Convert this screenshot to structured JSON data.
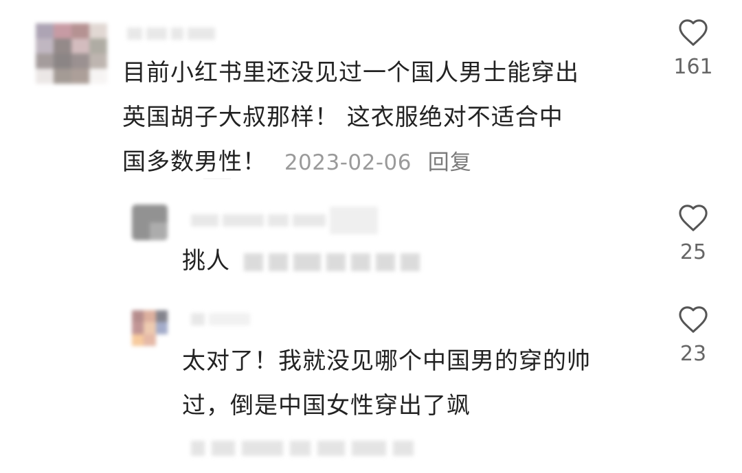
{
  "comments": [
    {
      "text_lines": [
        "目前小红书里还没见过一个国人男士能穿出",
        "英国胡子大叔那样！ 这衣服绝对不适合中",
        "国多数男性！"
      ],
      "date": "2023-02-06",
      "reply_label": "回复",
      "likes": "161"
    },
    {
      "text": "挑人",
      "likes": "25"
    },
    {
      "text_lines": [
        "太对了！我就没见哪个中国男的穿的帅",
        "过，倒是中国女性穿出了飒"
      ],
      "likes": "23"
    }
  ],
  "icons": {
    "like": "heart-outline-icon"
  },
  "colors": {
    "text": "#222222",
    "meta": "#9a9a9a",
    "like_icon": "#555555"
  }
}
